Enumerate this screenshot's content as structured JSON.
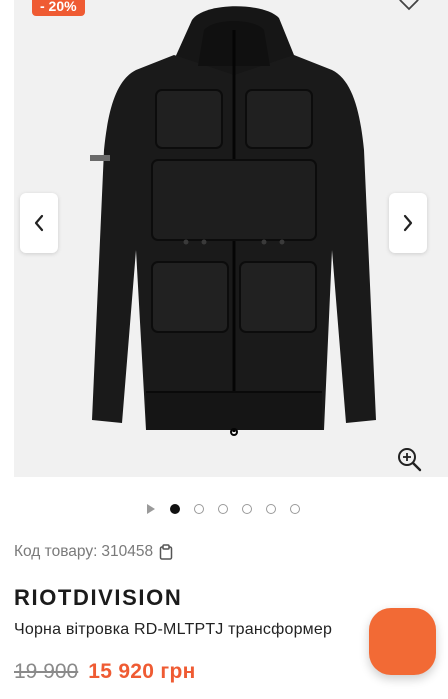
{
  "gallery": {
    "discount_badge": "- 20%",
    "favorite_icon": "heart-outline-icon",
    "prev_icon": "chevron-left-icon",
    "next_icon": "chevron-right-icon",
    "zoom_icon": "zoom-in-icon",
    "slide_count": 6,
    "active_slide": 1
  },
  "product": {
    "sku_label": "Код товару:",
    "sku_value": "310458",
    "brand": "RIOTDIVISION",
    "name": "Чорна вітровка RD-MLTPTJ трансформер",
    "old_price": "19 900",
    "new_price": "15 920 грн"
  },
  "colors": {
    "accent": "#ef5b33",
    "gallery_bg": "#f1f1f1"
  }
}
